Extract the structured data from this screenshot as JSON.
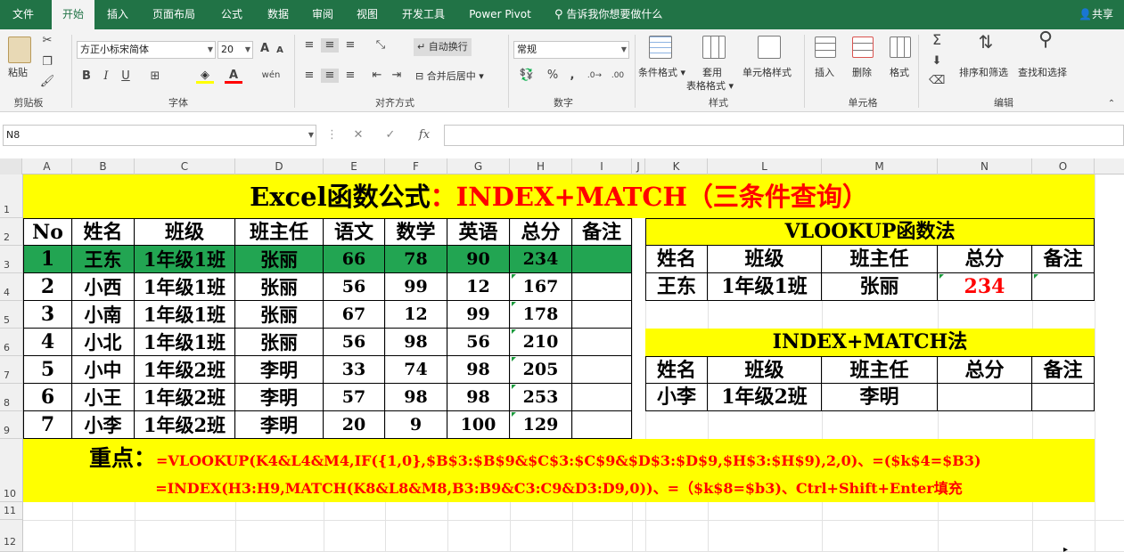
{
  "menu": {
    "tabs": [
      "文件",
      "开始",
      "插入",
      "页面布局",
      "公式",
      "数据",
      "审阅",
      "视图",
      "开发工具",
      "Power Pivot"
    ],
    "active": "开始",
    "tell_me": "告诉我你想要做什么",
    "share": "共享"
  },
  "ribbon": {
    "clipboard": {
      "paste": "粘贴",
      "label": "剪贴板"
    },
    "font": {
      "family": "方正小标宋简体",
      "size": "20",
      "label": "字体",
      "bold": "B",
      "italic": "I",
      "underline": "U",
      "grow": "A",
      "shrink": "A",
      "wen": "wén"
    },
    "alignment": {
      "wrap": "自动换行",
      "merge": "合并后居中",
      "label": "对齐方式"
    },
    "number": {
      "format": "常规",
      "label": "数字",
      "percent": "%",
      "comma": ","
    },
    "styles": {
      "conditional": "条件格式",
      "table1": "套用",
      "table2": "表格格式",
      "cell_styles": "单元格样式",
      "label": "样式"
    },
    "cells": {
      "insert": "插入",
      "delete": "删除",
      "format": "格式",
      "label": "单元格"
    },
    "editing": {
      "sum": "Σ",
      "sort": "排序和筛选",
      "find": "查找和选择",
      "label": "编辑"
    }
  },
  "formula_bar": {
    "name_box": "N8",
    "cancel": "✕",
    "enter": "✓",
    "fx": "fx",
    "formula": ""
  },
  "columns": [
    "A",
    "B",
    "C",
    "D",
    "E",
    "F",
    "G",
    "H",
    "I",
    "J",
    "K",
    "L",
    "M",
    "N",
    "O"
  ],
  "rows": [
    "1",
    "2",
    "3",
    "4",
    "5",
    "6",
    "7",
    "8",
    "9",
    "10",
    "11",
    "12"
  ],
  "sheet": {
    "title_black": "Excel函数公式",
    "title_red": "：INDEX+MATCH（三条件查询）",
    "headers": [
      "No",
      "姓名",
      "班级",
      "班主任",
      "语文",
      "数学",
      "英语",
      "总分",
      "备注"
    ],
    "data": [
      [
        "1",
        "王东",
        "1年级1班",
        "张丽",
        "66",
        "78",
        "90",
        "234",
        ""
      ],
      [
        "2",
        "小西",
        "1年级1班",
        "张丽",
        "56",
        "99",
        "12",
        "167",
        ""
      ],
      [
        "3",
        "小南",
        "1年级1班",
        "张丽",
        "67",
        "12",
        "99",
        "178",
        ""
      ],
      [
        "4",
        "小北",
        "1年级1班",
        "张丽",
        "56",
        "98",
        "56",
        "210",
        ""
      ],
      [
        "5",
        "小中",
        "1年级2班",
        "李明",
        "33",
        "74",
        "98",
        "205",
        ""
      ],
      [
        "6",
        "小王",
        "1年级2班",
        "李明",
        "57",
        "98",
        "98",
        "253",
        ""
      ],
      [
        "7",
        "小李",
        "1年级2班",
        "李明",
        "20",
        "9",
        "100",
        "129",
        ""
      ]
    ],
    "vlookup": {
      "title": "VLOOKUP函数法",
      "headers": [
        "姓名",
        "班级",
        "班主任",
        "总分",
        "备注"
      ],
      "row": [
        "王东",
        "1年级1班",
        "张丽",
        "234",
        ""
      ]
    },
    "index": {
      "title": "INDEX+MATCH法",
      "headers": [
        "姓名",
        "班级",
        "班主任",
        "总分",
        "备注"
      ],
      "row": [
        "小李",
        "1年级2班",
        "李明",
        "",
        ""
      ]
    },
    "key_label": "重点：",
    "formula1": "=VLOOKUP(K4&L4&M4,IF({1,0},$B$3:$B$9&$C$3:$C$9&$D$3:$D$9,$H$3:$H$9),2,0)、=($k$4=$B3)",
    "formula2": "=INDEX(H3:H9,MATCH(K8&L8&M8,B3:B9&C3:C9&D3:D9,0))、=（$k$8=$b3)、Ctrl+Shift+Enter填充"
  },
  "colors": {
    "excel_green": "#217346",
    "highlight_green": "#22a552",
    "yellow": "#ffff00",
    "red": "#ff0000"
  }
}
